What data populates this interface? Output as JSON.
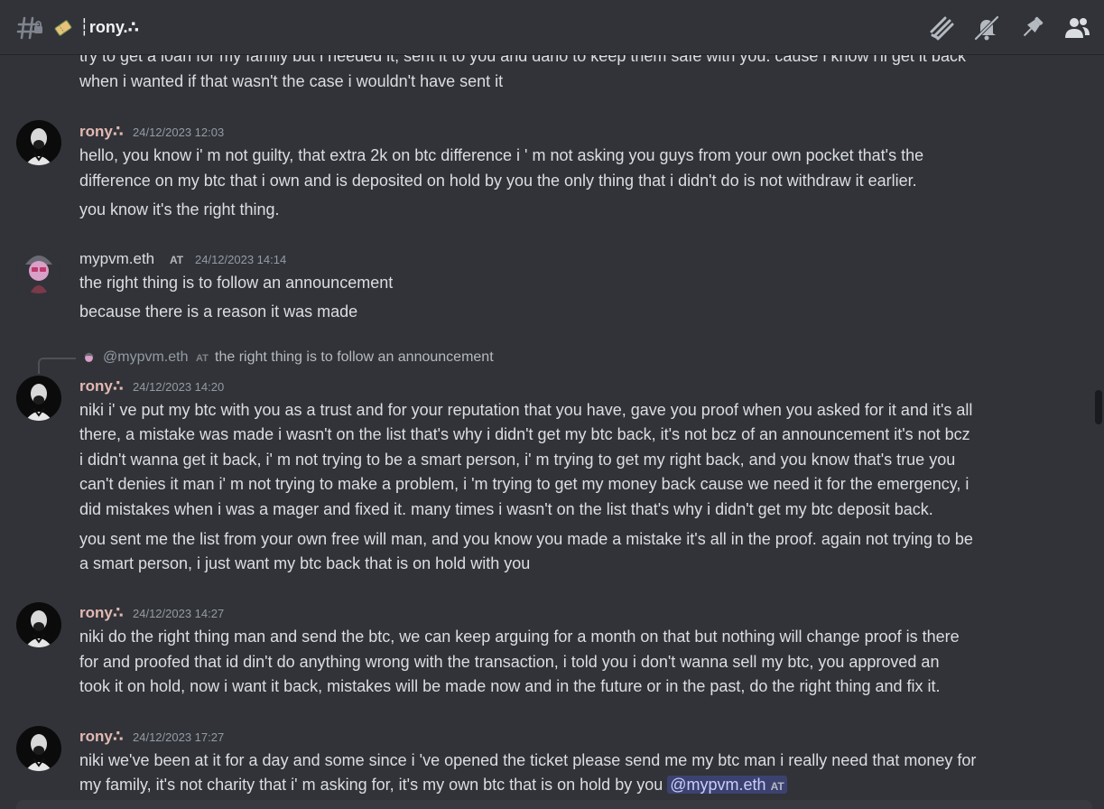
{
  "header": {
    "channel_emoji": "admission-ticket",
    "channel_name": "┆rony.∴",
    "icons": [
      "threads-icon",
      "notification-muted-icon",
      "pin-icon",
      "member-list-icon"
    ]
  },
  "messages": [
    {
      "lines": [
        "try to get a loan for my family but i needed it, sent it to you and dario to keep them safe with you. cause i know i'll get it back",
        "when i wanted if that wasn't the case i wouldn't have sent it"
      ]
    },
    {
      "author": "rony∴",
      "timestamp": "24/12/2023 12:03",
      "lines": [
        "hello, you know i' m not guilty, that extra 2k on btc difference i ' m not asking you guys from your own pocket that's the",
        "difference on my btc that i own and is deposited on hold by you the only thing that i didn't do is not withdraw it earlier.",
        "you know it's the right thing."
      ]
    },
    {
      "author": "mypvm.eth",
      "tag": "AT",
      "timestamp": "24/12/2023 14:14",
      "lines": [
        "the right thing is to follow an announcement",
        "because there is a reason it was made"
      ]
    },
    {
      "reply": {
        "author": "@mypvm.eth",
        "tag": "AT",
        "text": "the right thing is to follow an announcement"
      },
      "author": "rony∴",
      "timestamp": "24/12/2023 14:20",
      "lines": [
        "niki i' ve put my btc with you as a trust and for your reputation that you have, gave you proof when you asked for it and it's all",
        "there, a mistake was made i wasn't on the list that's why i didn't get my btc back, it's not bcz of an announcement it's not bcz",
        "i didn't wanna get it back, i' m not trying to be a smart person, i' m trying to get my right back, and you know that's true you",
        "can't denies it man i' m not trying to make a problem, i 'm trying to get my money back cause we need it for the emergency, i",
        "did mistakes when i was a mager and fixed it. many times i wasn't on the list that's why i didn't get my btc deposit back.",
        "you sent me the list from your own free will man, and you know you made a mistake it's all in the proof. again not trying to be",
        "a smart person, i just want my btc back that is on hold with you"
      ]
    },
    {
      "author": "rony∴",
      "timestamp": "24/12/2023 14:27",
      "lines": [
        "niki do the right thing man and send the btc, we can keep arguing for a month on that but nothing will change proof is there",
        "for and proofed that id din't do anything wrong with the transaction, i told you i don't wanna sell my btc, you approved an",
        "took it on hold, now i want it back, mistakes will be made now and in the future or in the past, do the right thing and fix it."
      ]
    },
    {
      "author": "rony∴",
      "timestamp": "24/12/2023 17:27",
      "lines": [
        "niki we've been at it for a day and some since i 've opened the ticket please send me my btc man i really need that money for",
        "my family, it's not charity that i' m asking for, it's my own btc that is on hold by you"
      ],
      "mention": {
        "name": "@mypvm.eth",
        "tag": "AT"
      }
    }
  ],
  "colors": {
    "background": "#313338",
    "mention_bg": "#3c4270",
    "rony_name": "#e3b9b3"
  }
}
